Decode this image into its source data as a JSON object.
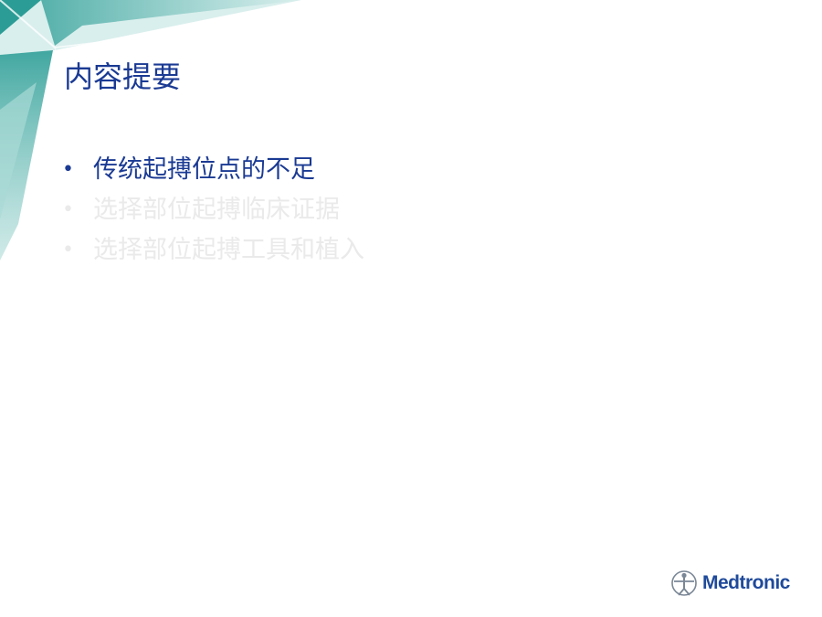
{
  "slide": {
    "title": "内容提要",
    "bullets": [
      {
        "text": "传统起搏位点的不足",
        "state": "active"
      },
      {
        "text": "选择部位起搏临床证据",
        "state": "dimmed"
      },
      {
        "text": "选择部位起搏工具和植入",
        "state": "dimmed"
      }
    ],
    "bullet_glyph": "•"
  },
  "logo": {
    "text": "Medtronic",
    "icon": "medtronic-figure-icon"
  },
  "colors": {
    "title": "#1a3a93",
    "active_bullet": "#1a3a93",
    "dimmed_bullet": "#eaeaea",
    "teal_dark": "#2a9a93",
    "teal_light": "#bfe3df",
    "logo": "#1f4a9b"
  }
}
